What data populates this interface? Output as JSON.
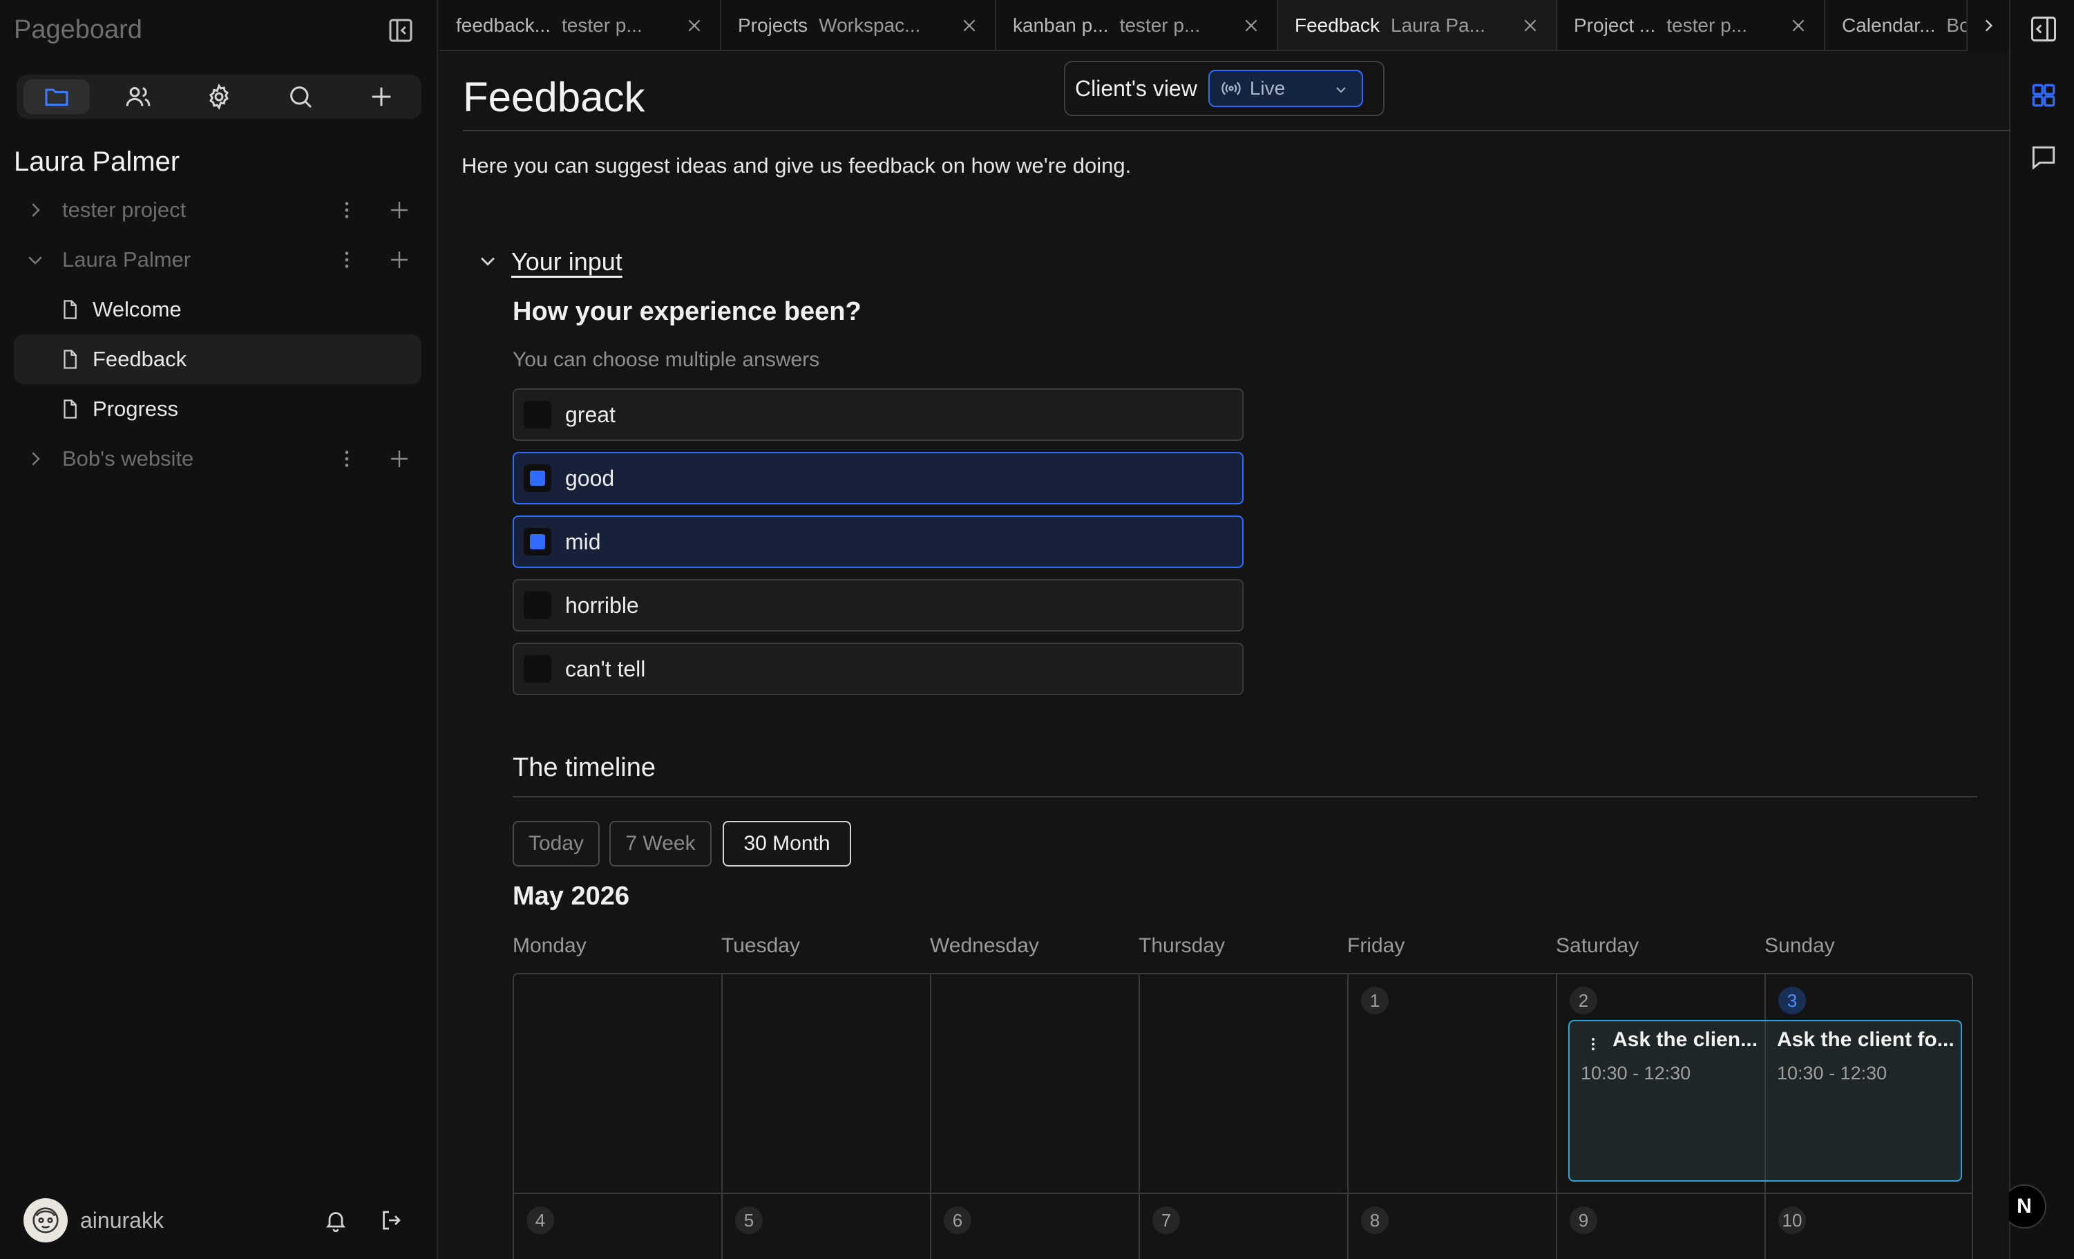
{
  "app": {
    "brand": "Pageboard"
  },
  "sidebar": {
    "workspace_title": "Laura Palmer",
    "tree": [
      {
        "label": "tester project",
        "type": "folder",
        "expanded": false
      },
      {
        "label": "Laura Palmer",
        "type": "folder",
        "expanded": true
      },
      {
        "label": "Welcome",
        "type": "page"
      },
      {
        "label": "Feedback",
        "type": "page",
        "selected": true
      },
      {
        "label": "Progress",
        "type": "page"
      },
      {
        "label": "Bob's website",
        "type": "folder",
        "expanded": false
      }
    ],
    "user": {
      "name": "ainurakk"
    }
  },
  "tabs": [
    {
      "title": "feedback...",
      "sub": "tester p..."
    },
    {
      "title": "Projects",
      "sub": "Workspac..."
    },
    {
      "title": "kanban p...",
      "sub": "tester p..."
    },
    {
      "title": "Feedback",
      "sub": "Laura Pa...",
      "active": true
    },
    {
      "title": "Project ...",
      "sub": "tester p..."
    },
    {
      "title": "Calendar...",
      "sub": "Bo"
    }
  ],
  "page": {
    "title": "Feedback",
    "intro": "Here you can suggest ideas and give us feedback on how we're doing.",
    "client_view": {
      "label": "Client's view",
      "mode": "Live"
    },
    "section": {
      "title": "Your input"
    },
    "question": {
      "title": "How your experience been?",
      "subtitle": "You can choose multiple answers",
      "options": [
        {
          "label": "great",
          "checked": false
        },
        {
          "label": "good",
          "checked": true
        },
        {
          "label": "mid",
          "checked": true
        },
        {
          "label": "horrible",
          "checked": false
        },
        {
          "label": "can't tell",
          "checked": false
        }
      ]
    },
    "timeline": {
      "title": "The timeline",
      "views": [
        "Today",
        "7 Week",
        "30 Month"
      ],
      "active_view": "30 Month",
      "month": "May 2026",
      "weekdays": [
        "Monday",
        "Tuesday",
        "Wednesday",
        "Thursday",
        "Friday",
        "Saturday",
        "Sunday"
      ],
      "week1_days": [
        "1",
        "2",
        "3"
      ],
      "week2_days": [
        "4",
        "5",
        "6",
        "7",
        "8",
        "9",
        "10"
      ],
      "today": "3",
      "event": {
        "title_a": "Ask the clien...",
        "title_b": "Ask the client fo...",
        "time": "10:30 - 12:30"
      }
    }
  },
  "colors": {
    "accent": "#2f6bff",
    "event_border": "#2aa7d8",
    "background": "#141414"
  },
  "icons": [
    "sidebar-collapse-icon",
    "folder-icon",
    "users-icon",
    "gear-icon",
    "search-icon",
    "plus-icon",
    "chevron-right-icon",
    "chevron-down-icon",
    "more-vertical-icon",
    "document-icon",
    "bell-icon",
    "logout-icon",
    "close-icon",
    "grid-icon",
    "comment-icon",
    "broadcast-icon"
  ]
}
